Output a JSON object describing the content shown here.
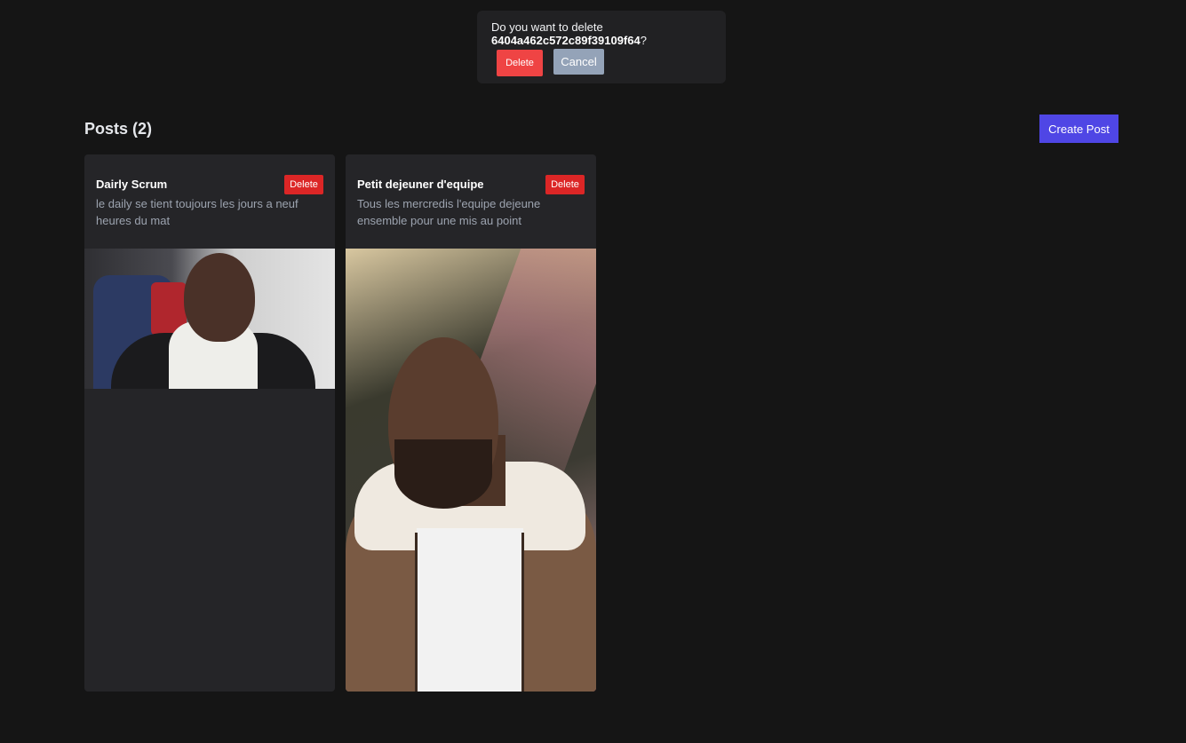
{
  "toast": {
    "message": "Do you want to delete",
    "id": "6404a462c572c89f39109f64",
    "suffix": "?",
    "delete_label": "Delete",
    "cancel_label": "Cancel"
  },
  "header": {
    "title": "Posts (2)",
    "create_label": "Create Post"
  },
  "posts": [
    {
      "title": "Dairly Scrum",
      "description": "le daily se tient toujours les jours a neuf heures du mat",
      "delete_label": "Delete"
    },
    {
      "title": "Petit dejeuner d'equipe",
      "description": "Tous les mercredis l'equipe dejeune ensemble pour une mis au point",
      "delete_label": "Delete"
    }
  ],
  "colors": {
    "background": "#151515",
    "card": "#252528",
    "danger": "#dc2626",
    "primary": "#4f46e5",
    "cancel": "#94a3b8"
  }
}
